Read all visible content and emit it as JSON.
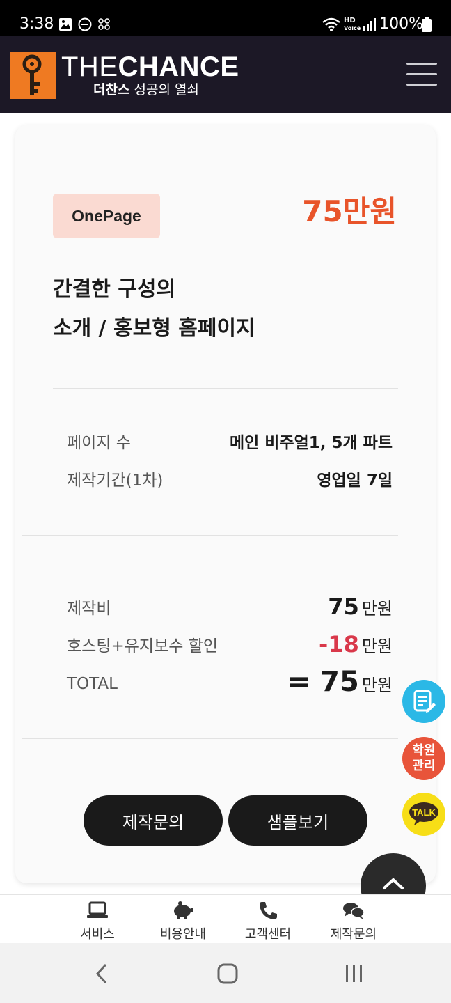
{
  "status_bar": {
    "time": "3:38",
    "battery": "100%",
    "hd_label": "HD",
    "voice_label": "Voice"
  },
  "header": {
    "brand_thin": "THE",
    "brand_bold": "CHANCE",
    "tagline_bold": "더찬스",
    "tagline_rest": "성공의 열쇠",
    "logo_color": "#ef7a22",
    "bg_color": "#1c1826"
  },
  "plan": {
    "badge": "OnePage",
    "price": "75만원",
    "title_line1": "간결한 구성의",
    "title_line2": "소개 / 홍보형 홈페이지",
    "details": [
      {
        "label": "페이지 수",
        "value": "메인 비주얼1, 5개 파트"
      },
      {
        "label": "제작기간(1차)",
        "value": "영업일 7일"
      }
    ],
    "costs": [
      {
        "label": "제작비",
        "amount": "75",
        "unit": "만원"
      },
      {
        "label": "호스팅+유지보수 할인",
        "amount": "-18",
        "unit": "만원"
      },
      {
        "label": "TOTAL",
        "amount": "= 75",
        "unit": "만원"
      }
    ],
    "buttons": {
      "inquiry": "제작문의",
      "sample": "샘플보기"
    },
    "accent_color": "#e8542a",
    "discount_color": "#d9384a"
  },
  "floating": {
    "academy_line1": "학원",
    "academy_line2": "관리",
    "talk": "TALK"
  },
  "bottom_nav": [
    {
      "label": "서비스",
      "icon": "laptop-icon"
    },
    {
      "label": "비용안내",
      "icon": "piggy-bank-icon"
    },
    {
      "label": "고객센터",
      "icon": "phone-icon"
    },
    {
      "label": "제작문의",
      "icon": "chat-bubbles-icon"
    }
  ]
}
